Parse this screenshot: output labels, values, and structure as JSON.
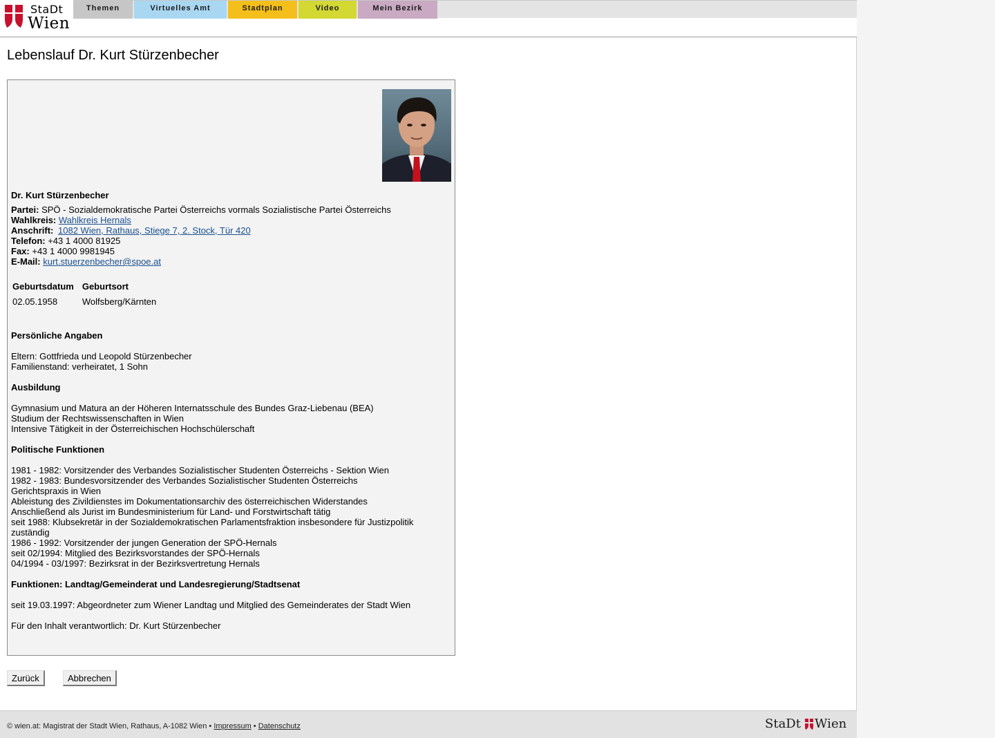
{
  "logo": {
    "line1": "StaDt",
    "line2": "Wien"
  },
  "nav": {
    "tabs": [
      {
        "label": "Themen",
        "color": "#c6c6c6"
      },
      {
        "label": "Virtuelles Amt",
        "color": "#a9d7f2"
      },
      {
        "label": "Stadtplan",
        "color": "#f5bf1b"
      },
      {
        "label": "Video",
        "color": "#d3d832"
      },
      {
        "label": "Mein Bezirk",
        "color": "#c9aac2"
      }
    ]
  },
  "page_title": "Lebenslauf Dr. Kurt Stürzenbecher",
  "person": {
    "name": "Dr. Kurt Stürzenbecher",
    "partei_label": "Partei:",
    "partei_value": "SPÖ - Sozialdemokratische Partei Österreichs vormals Sozialistische Partei Österreichs",
    "wahlkreis_label": "Wahlkreis:",
    "wahlkreis_value": "Wahlkreis Hernals",
    "anschrift_label": "Anschrift:",
    "anschrift_value": "1082 Wien, Rathaus, Stiege 7, 2. Stock, Tür 420",
    "telefon_label": "Telefon:",
    "telefon_value": "+43 1 4000 81925",
    "fax_label": "Fax:",
    "fax_value": "+43 1 4000 9981945",
    "email_label": "E-Mail:",
    "email_value": "kurt.stuerzenbecher@spoe.at"
  },
  "birth_table": {
    "headers": [
      "Geburtsdatum",
      "Geburtsort"
    ],
    "row": [
      "02.05.1958",
      "Wolfsberg/Kärnten"
    ]
  },
  "sections": {
    "personal": {
      "heading": "Persönliche Angaben",
      "lines": [
        "Eltern: Gottfrieda und Leopold Stürzenbecher",
        "Familienstand: verheiratet, 1 Sohn"
      ]
    },
    "education": {
      "heading": "Ausbildung",
      "lines": [
        "Gymnasium und Matura an der Höheren Internatsschule des Bundes Graz-Liebenau (BEA)",
        "Studium der Rechtswissenschaften in Wien",
        "Intensive Tätigkeit in der Österreichischen Hochschülerschaft"
      ]
    },
    "political": {
      "heading": "Politische Funktionen",
      "lines": [
        "1981 - 1982: Vorsitzender des Verbandes Sozialistischer Studenten Österreichs - Sektion Wien",
        "1982 - 1983: Bundesvorsitzender des Verbandes Sozialistischer Studenten Österreichs",
        "Gerichtspraxis in Wien",
        "Ableistung des Zivildienstes im Dokumentationsarchiv des österreichischen Widerstandes",
        "Anschließend als Jurist im Bundesministerium für Land- und Forstwirtschaft tätig",
        "seit 1988: Klubsekretär in der Sozialdemokratischen Parlamentsfraktion insbesondere für Justizpolitik",
        "zuständig",
        "1986 - 1992: Vorsitzender der jungen Generation der SPÖ-Hernals",
        "seit 02/1994: Mitglied des Bezirksvorstandes der SPÖ-Hernals",
        "04/1994 - 03/1997: Bezirksrat in der Bezirksvertretung Hernals"
      ]
    },
    "functions": {
      "heading": "Funktionen: Landtag/Gemeinderat und Landesregierung/Stadtsenat",
      "lines": [
        "seit 19.03.1997: Abgeordneter zum Wiener Landtag und Mitglied des Gemeinderates der Stadt Wien"
      ]
    },
    "responsible": "Für den Inhalt verantwortlich: Dr. Kurt Stürzenbecher"
  },
  "buttons": {
    "back": "Zurück",
    "cancel": "Abbrechen"
  },
  "footer": {
    "text": "© wien.at: Magistrat der Stadt Wien, Rathaus, A-1082 Wien •",
    "impressum": "Impressum",
    "sep": "•",
    "datenschutz": "Datenschutz",
    "logo_left": "StaDt",
    "logo_right": "Wien"
  }
}
